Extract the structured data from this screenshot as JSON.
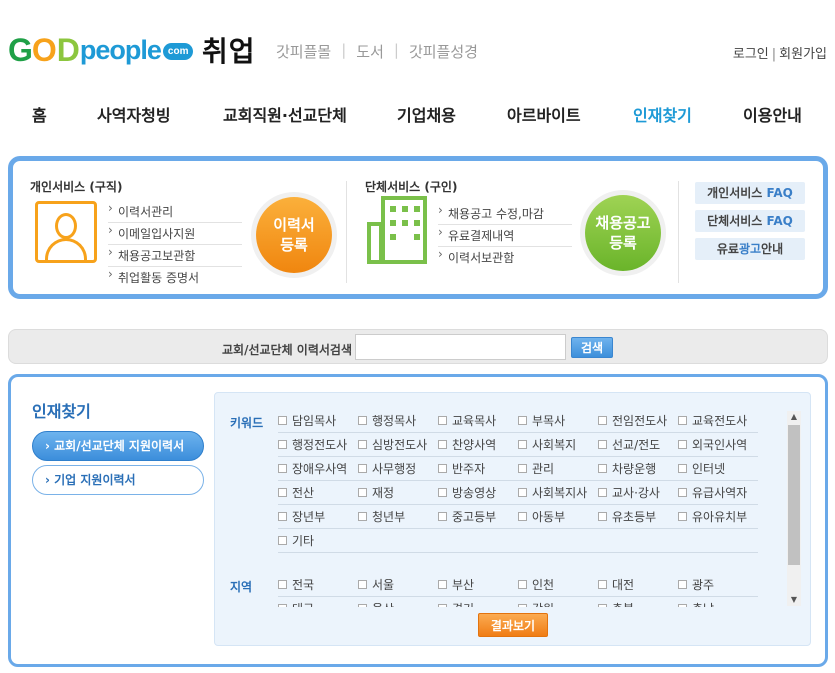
{
  "header": {
    "logo": {
      "g": "G",
      "o": "O",
      "d": "D",
      "people": "people",
      "com": "com"
    },
    "title": "취업",
    "sub_links": [
      "갓피플몰",
      "도서",
      "갓피플성경"
    ],
    "auth": {
      "login": "로그인",
      "signup": "회원가입",
      "separator": "|"
    }
  },
  "nav": {
    "items": [
      "홈",
      "사역자청빙",
      "교회직원·선교단체",
      "기업채용",
      "아르바이트",
      "인재찾기",
      "이용안내"
    ],
    "active": "인재찾기"
  },
  "services": {
    "personal": {
      "title": "개인서비스 (구직)",
      "items": [
        "이력서관리",
        "이메일입사지원",
        "채용공고보관함",
        "취업활동 증명서"
      ],
      "button": [
        "이력서",
        "등록"
      ]
    },
    "company": {
      "title": "단체서비스 (구인)",
      "items": [
        "채용공고 수정,마감",
        "유료결제내역",
        "이력서보관함"
      ],
      "button": [
        "채용공고",
        "등록"
      ]
    },
    "faq": {
      "personal_pre": "개인서비스 ",
      "personal_hl": "FAQ",
      "company_pre": "단체서비스 ",
      "company_hl": "FAQ",
      "ad_pre": "유료",
      "ad_hl": "광고",
      "ad_post": "안내"
    }
  },
  "search": {
    "label": "교회/선교단체 이력서검색",
    "input_value": "",
    "button": "검색"
  },
  "main": {
    "title": "인재찾기",
    "tabs": [
      "› 교회/선교단체 지원이력서",
      "› 기업 지원이력서"
    ],
    "keyword_label": "키워드",
    "keywords": [
      [
        "담임목사",
        "행정목사",
        "교육목사",
        "부목사",
        "전임전도사",
        "교육전도사"
      ],
      [
        "행정전도사",
        "심방전도사",
        "찬양사역",
        "사회복지",
        "선교/전도",
        "외국인사역"
      ],
      [
        "장애우사역",
        "사무행정",
        "반주자",
        "관리",
        "차량운행",
        "인터넷"
      ],
      [
        "전산",
        "재정",
        "방송영상",
        "사회복지사",
        "교사·강사",
        "유급사역자"
      ],
      [
        "장년부",
        "청년부",
        "중고등부",
        "아동부",
        "유초등부",
        "유아유치부"
      ],
      [
        "기타"
      ]
    ],
    "region_label": "지역",
    "regions": [
      [
        "전국",
        "서울",
        "부산",
        "인천",
        "대전",
        "광주"
      ],
      [
        "대구",
        "울산",
        "경기",
        "강원",
        "충북",
        "충남"
      ]
    ],
    "result_button": "결과보기"
  },
  "colors": {
    "accent_blue": "#1e9ad6",
    "panel_border": "#6aa9e9",
    "orange": "#f7a21b",
    "green": "#7ac04a"
  }
}
